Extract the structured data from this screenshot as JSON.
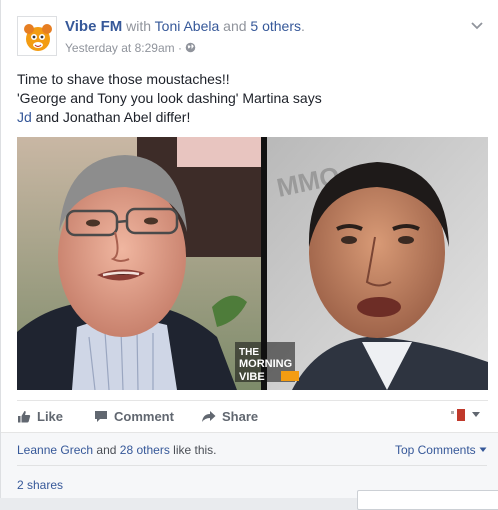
{
  "post": {
    "page_name": "Vibe FM",
    "with_word": "with",
    "tagged_person": "Toni Abela",
    "and_word": "and",
    "others": "5 others",
    "trailing_period": ".",
    "timestamp": "Yesterday at 8:29am",
    "separator": "·",
    "text_lines": [
      "Time to shave those moustaches!!",
      "'George and Tony you look dashing' Martina says"
    ],
    "mention": "Jd",
    "last_line_rest": " and Jonathan Abel differ!",
    "photo_caption_1": "THE",
    "photo_caption_2": "MORNING",
    "photo_caption_3": "VIBE"
  },
  "actions": {
    "like_label": "Like",
    "comment_label": "Comment",
    "share_label": "Share"
  },
  "footer": {
    "liker_name": "Leanne Grech",
    "and_word": "and",
    "others_count": "28 others",
    "like_suffix": "like this.",
    "top_comments": "Top Comments",
    "shares": "2 shares"
  },
  "colors": {
    "link": "#365899",
    "muted": "#90949c",
    "action": "#616770"
  }
}
